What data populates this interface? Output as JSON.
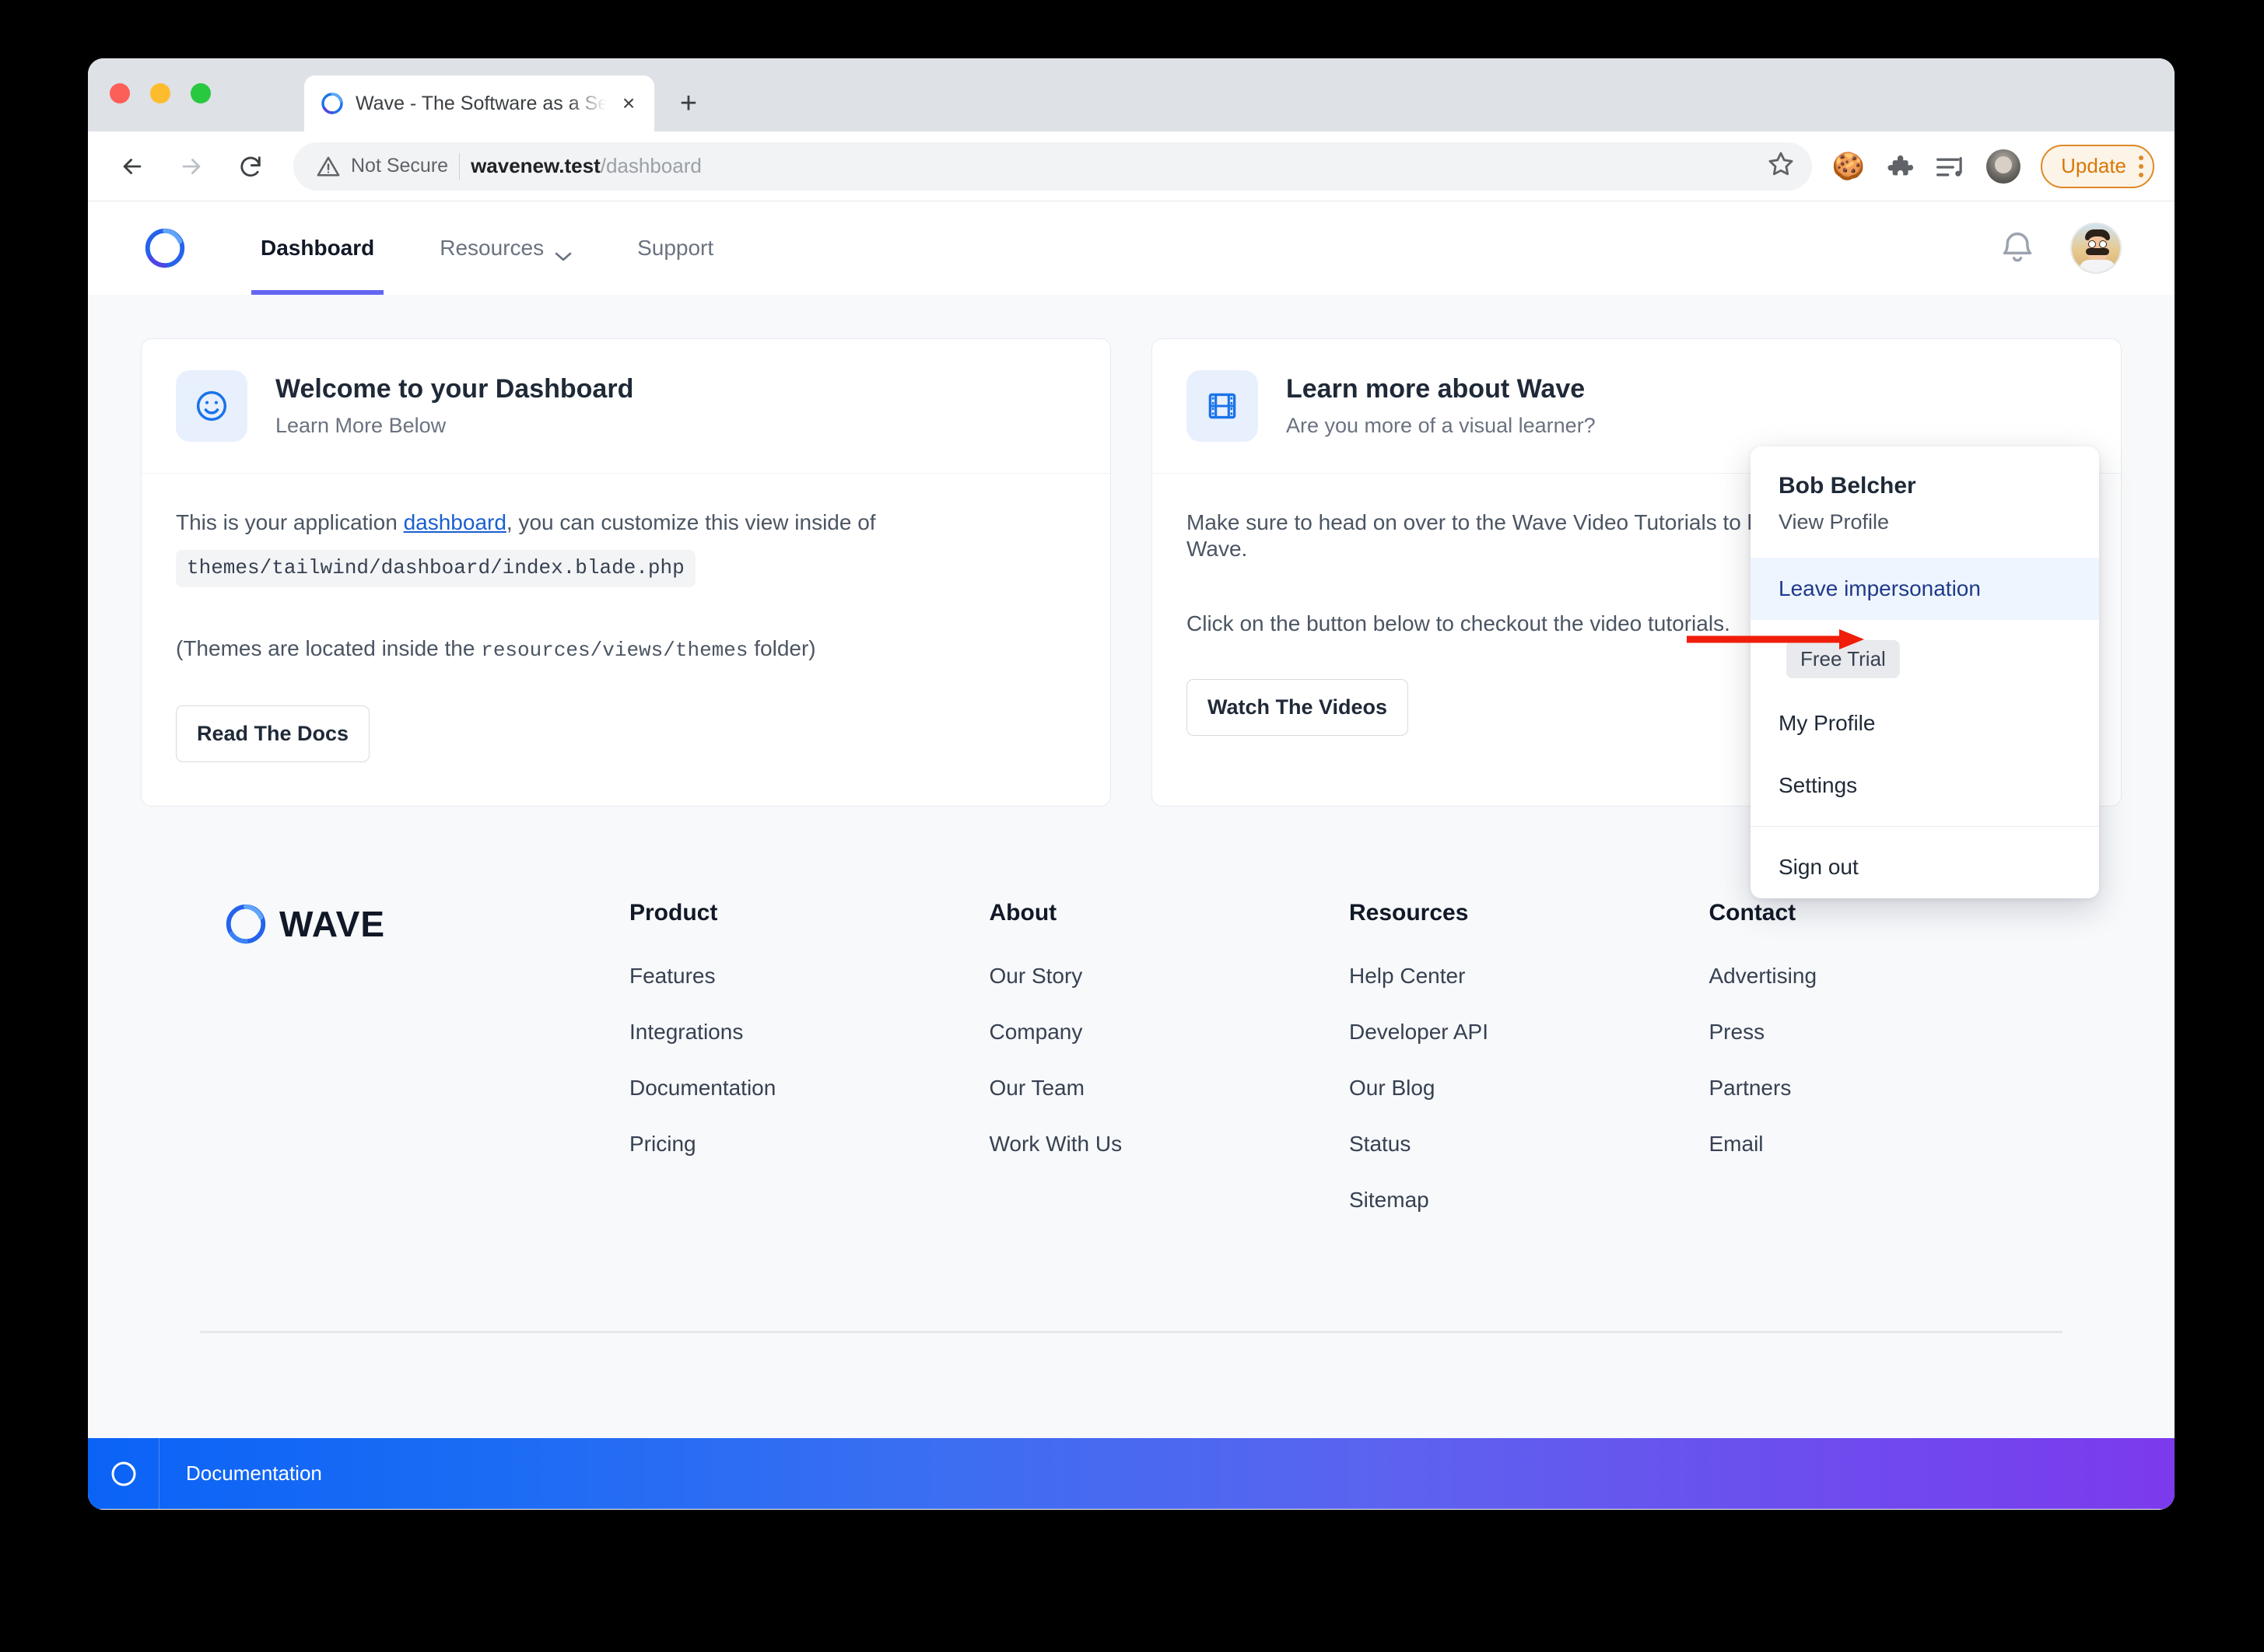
{
  "browser": {
    "tab": {
      "title": "Wave - The Software as a Serv",
      "favicon": "wave-logo-icon",
      "close": "×"
    },
    "new_tab_label": "+",
    "toolbar": {
      "back": "←",
      "forward": "→",
      "reload": "↻",
      "security_label": "Not Secure",
      "url_host": "wavenew.test",
      "url_path": "/dashboard",
      "bookmark_icon": "star-icon",
      "cookie_icon": "🍪",
      "extensions_icon": "puzzle-piece-icon",
      "media_icon": "media-playlist-icon",
      "profile_icon": "profile-avatar",
      "update_label": "Update",
      "menu_icon": "kebab-menu-icon"
    }
  },
  "app": {
    "nav": {
      "brand": "wave-logo-icon",
      "links": [
        {
          "label": "Dashboard",
          "active": true,
          "has_chevron": false
        },
        {
          "label": "Resources",
          "active": false,
          "has_chevron": true
        },
        {
          "label": "Support",
          "active": false,
          "has_chevron": false
        }
      ],
      "bell_icon": "notification-bell-icon",
      "avatar": "user-avatar"
    },
    "cards": [
      {
        "icon": "smiley-face-icon",
        "title": "Welcome to your Dashboard",
        "subtitle": "Learn More Below",
        "para1_before": "This is your application ",
        "para1_link": "dashboard",
        "para1_after": ", you can customize this view inside of",
        "code_path": "themes/tailwind/dashboard/index.blade.php",
        "para2_before": "(Themes are located inside the ",
        "para2_code": "resources/views/themes",
        "para2_after": " folder)",
        "button": "Read The Docs"
      },
      {
        "icon": "film-strip-icon",
        "title": "Learn more about Wave",
        "subtitle": "Are you more of a visual learner?",
        "para1": "Make sure to head on over to the Wave Video Tutorials to learn how to use and customize Wave.",
        "para2": "Click on the button below to checkout the video tutorials.",
        "button": "Watch The Videos"
      }
    ],
    "dropdown": {
      "name": "Bob Belcher",
      "view_profile": "View Profile",
      "highlighted_item": "Leave impersonation",
      "badge": "Free Trial",
      "items": [
        {
          "label": "My Profile"
        },
        {
          "label": "Settings"
        }
      ],
      "sign_out": "Sign out"
    },
    "annotation": {
      "type": "red-arrow",
      "points_to": "Leave impersonation"
    },
    "footer": {
      "brand_text": "WAVE",
      "columns": [
        {
          "heading": "Product",
          "links": [
            "Features",
            "Integrations",
            "Documentation",
            "Pricing"
          ]
        },
        {
          "heading": "About",
          "links": [
            "Our Story",
            "Company",
            "Our Team",
            "Work With Us"
          ]
        },
        {
          "heading": "Resources",
          "links": [
            "Help Center",
            "Developer API",
            "Our Blog",
            "Status",
            "Sitemap"
          ]
        },
        {
          "heading": "Contact",
          "links": [
            "Advertising",
            "Press",
            "Partners",
            "Email"
          ]
        }
      ]
    },
    "bottom_bar": {
      "logo": "wave-logo-icon",
      "link": "Documentation"
    }
  },
  "colors": {
    "accent": "#6366f1",
    "link": "#1a5fd0",
    "icon_blue": "#1a73e8",
    "annotation_red": "#f01d0a",
    "update_orange": "#d97706",
    "bar_gradient_from": "#0b63f6",
    "bar_gradient_to": "#7c3aed"
  }
}
